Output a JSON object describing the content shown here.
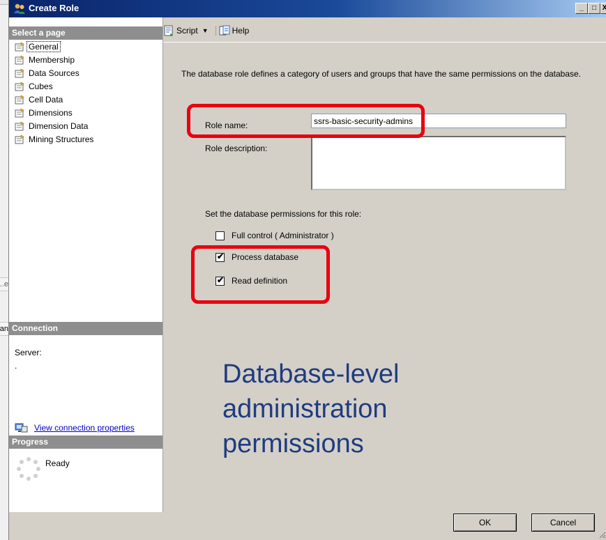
{
  "background": {
    "fragment1": "e...",
    "fragment2": "an"
  },
  "window": {
    "title": "Create Role",
    "min_glyph": "_",
    "max_glyph": "□",
    "close_glyph": "X"
  },
  "sidebar": {
    "header": "Select a page",
    "pages": [
      {
        "label": "General",
        "selected": true
      },
      {
        "label": "Membership"
      },
      {
        "label": "Data Sources"
      },
      {
        "label": "Cubes"
      },
      {
        "label": "Cell Data"
      },
      {
        "label": "Dimensions"
      },
      {
        "label": "Dimension Data"
      },
      {
        "label": "Mining Structures"
      }
    ]
  },
  "connection": {
    "header": "Connection",
    "server_label": "Server:",
    "server_value": ".",
    "link": "View connection properties"
  },
  "progress": {
    "header": "Progress",
    "status": "Ready"
  },
  "toolbar": {
    "script": "Script",
    "help": "Help"
  },
  "form": {
    "description": "The database role defines a category of users and groups that have the same permissions on the database.",
    "role_name_label": "Role name:",
    "role_name_value": "ssrs-basic-security-admins",
    "role_desc_label": "Role description:",
    "role_desc_value": "",
    "permissions_title": "Set the database permissions for this role:",
    "permissions": [
      {
        "label": "Full control ( Administrator )",
        "checked": false
      },
      {
        "label": "Process database",
        "checked": true
      },
      {
        "label": "Read definition",
        "checked": true
      }
    ]
  },
  "overlay": {
    "lines": [
      "Database-level",
      "administration",
      "permissions"
    ]
  },
  "buttons": {
    "ok": "OK",
    "cancel": "Cancel"
  },
  "colors": {
    "callout": "#e8000f",
    "overlay_text": "#1f3c7f",
    "section_header": "#8e8e8e"
  }
}
